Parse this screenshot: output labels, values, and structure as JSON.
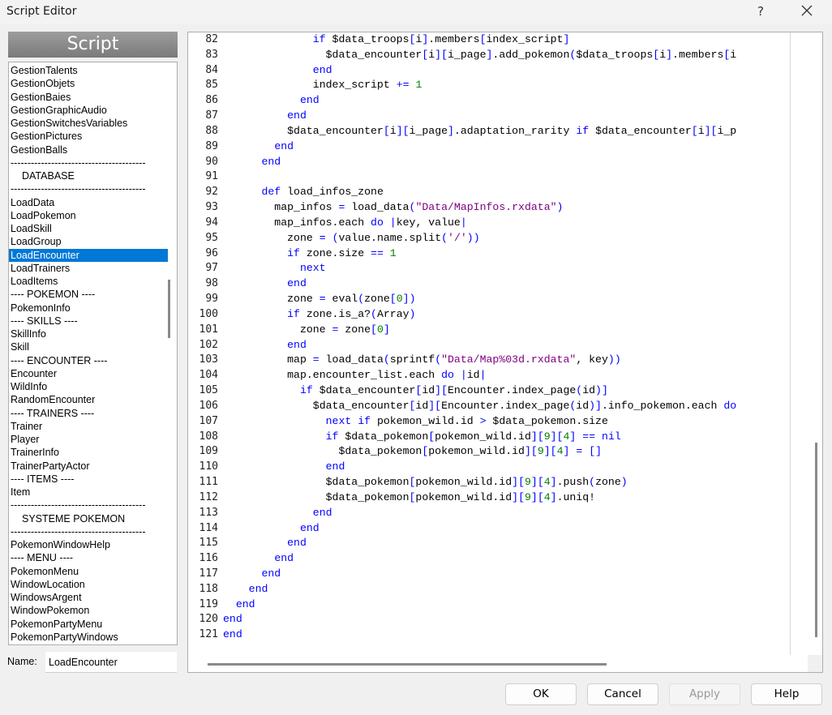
{
  "window": {
    "title": "Script Editor",
    "help_glyph": "?",
    "close_icon": "close-icon"
  },
  "sidebar": {
    "header": "Script",
    "items": [
      {
        "label": "GestionTalents"
      },
      {
        "label": "GestionObjets"
      },
      {
        "label": "GestionBaies"
      },
      {
        "label": "GestionGraphicAudio"
      },
      {
        "label": "GestionSwitchesVariables"
      },
      {
        "label": "GestionPictures"
      },
      {
        "label": "GestionBalls"
      },
      {
        "label": "----------------------------------------"
      },
      {
        "label": "DATABASE",
        "center": true
      },
      {
        "label": "----------------------------------------"
      },
      {
        "label": "LoadData"
      },
      {
        "label": "LoadPokemon"
      },
      {
        "label": "LoadSkill"
      },
      {
        "label": "LoadGroup"
      },
      {
        "label": "LoadEncounter",
        "selected": true
      },
      {
        "label": "LoadTrainers"
      },
      {
        "label": "LoadItems"
      },
      {
        "label": "---- POKEMON ----"
      },
      {
        "label": "PokemonInfo"
      },
      {
        "label": "---- SKILLS ----"
      },
      {
        "label": "SkillInfo"
      },
      {
        "label": "Skill"
      },
      {
        "label": "---- ENCOUNTER ----"
      },
      {
        "label": "Encounter"
      },
      {
        "label": "WildInfo"
      },
      {
        "label": "RandomEncounter"
      },
      {
        "label": "---- TRAINERS ----"
      },
      {
        "label": "Trainer"
      },
      {
        "label": "Player"
      },
      {
        "label": "TrainerInfo"
      },
      {
        "label": "TrainerPartyActor"
      },
      {
        "label": "---- ITEMS ----"
      },
      {
        "label": "Item"
      },
      {
        "label": "----------------------------------------"
      },
      {
        "label": "SYSTEME POKEMON",
        "center": true
      },
      {
        "label": "----------------------------------------"
      },
      {
        "label": "PokemonWindowHelp"
      },
      {
        "label": "---- MENU ----"
      },
      {
        "label": "PokemonMenu"
      },
      {
        "label": "WindowLocation"
      },
      {
        "label": "WindowsArgent"
      },
      {
        "label": "WindowPokemon"
      },
      {
        "label": "PokemonPartyMenu"
      },
      {
        "label": "PokemonPartyWindows"
      }
    ]
  },
  "name_field": {
    "label": "Name:",
    "value": "LoadEncounter"
  },
  "editor": {
    "lines": [
      {
        "n": "82",
        "code": "              if $data_troops[i].members[index_script]"
      },
      {
        "n": "83",
        "code": "                $data_encounter[i][i_page].add_pokemon($data_troops[i].members[i"
      },
      {
        "n": "84",
        "code": "              end"
      },
      {
        "n": "85",
        "code": "              index_script += 1"
      },
      {
        "n": "86",
        "code": "            end"
      },
      {
        "n": "87",
        "code": "          end"
      },
      {
        "n": "88",
        "code": "          $data_encounter[i][i_page].adaptation_rarity if $data_encounter[i][i_p"
      },
      {
        "n": "89",
        "code": "        end"
      },
      {
        "n": "90",
        "code": "      end"
      },
      {
        "n": "91",
        "code": ""
      },
      {
        "n": "92",
        "code": "      def load_infos_zone"
      },
      {
        "n": "93",
        "code": "        map_infos = load_data(\"Data/MapInfos.rxdata\")"
      },
      {
        "n": "94",
        "code": "        map_infos.each do |key, value|"
      },
      {
        "n": "95",
        "code": "          zone = (value.name.split('/'))"
      },
      {
        "n": "96",
        "code": "          if zone.size == 1"
      },
      {
        "n": "97",
        "code": "            next"
      },
      {
        "n": "98",
        "code": "          end"
      },
      {
        "n": "99",
        "code": "          zone = eval(zone[0])"
      },
      {
        "n": "100",
        "code": "          if zone.is_a?(Array)"
      },
      {
        "n": "101",
        "code": "            zone = zone[0]"
      },
      {
        "n": "102",
        "code": "          end"
      },
      {
        "n": "103",
        "code": "          map = load_data(sprintf(\"Data/Map%03d.rxdata\", key))"
      },
      {
        "n": "104",
        "code": "          map.encounter_list.each do |id|"
      },
      {
        "n": "105",
        "code": "            if $data_encounter[id][Encounter.index_page(id)]"
      },
      {
        "n": "106",
        "code": "              $data_encounter[id][Encounter.index_page(id)].info_pokemon.each do"
      },
      {
        "n": "107",
        "code": "                next if pokemon_wild.id > $data_pokemon.size"
      },
      {
        "n": "108",
        "code": "                if $data_pokemon[pokemon_wild.id][9][4] == nil"
      },
      {
        "n": "109",
        "code": "                  $data_pokemon[pokemon_wild.id][9][4] = []"
      },
      {
        "n": "110",
        "code": "                end"
      },
      {
        "n": "111",
        "code": "                $data_pokemon[pokemon_wild.id][9][4].push(zone)"
      },
      {
        "n": "112",
        "code": "                $data_pokemon[pokemon_wild.id][9][4].uniq!"
      },
      {
        "n": "113",
        "code": "              end"
      },
      {
        "n": "114",
        "code": "            end"
      },
      {
        "n": "115",
        "code": "          end"
      },
      {
        "n": "116",
        "code": "        end"
      },
      {
        "n": "117",
        "code": "      end"
      },
      {
        "n": "118",
        "code": "    end"
      },
      {
        "n": "119",
        "code": "  end"
      },
      {
        "n": "120",
        "code": "end"
      },
      {
        "n": "121",
        "code": "end"
      }
    ]
  },
  "buttons": {
    "ok": "OK",
    "cancel": "Cancel",
    "apply": "Apply",
    "help": "Help"
  },
  "colors": {
    "selection": "#0078d7",
    "keyword": "#0000ff",
    "string": "#800080",
    "number": "#008000"
  }
}
